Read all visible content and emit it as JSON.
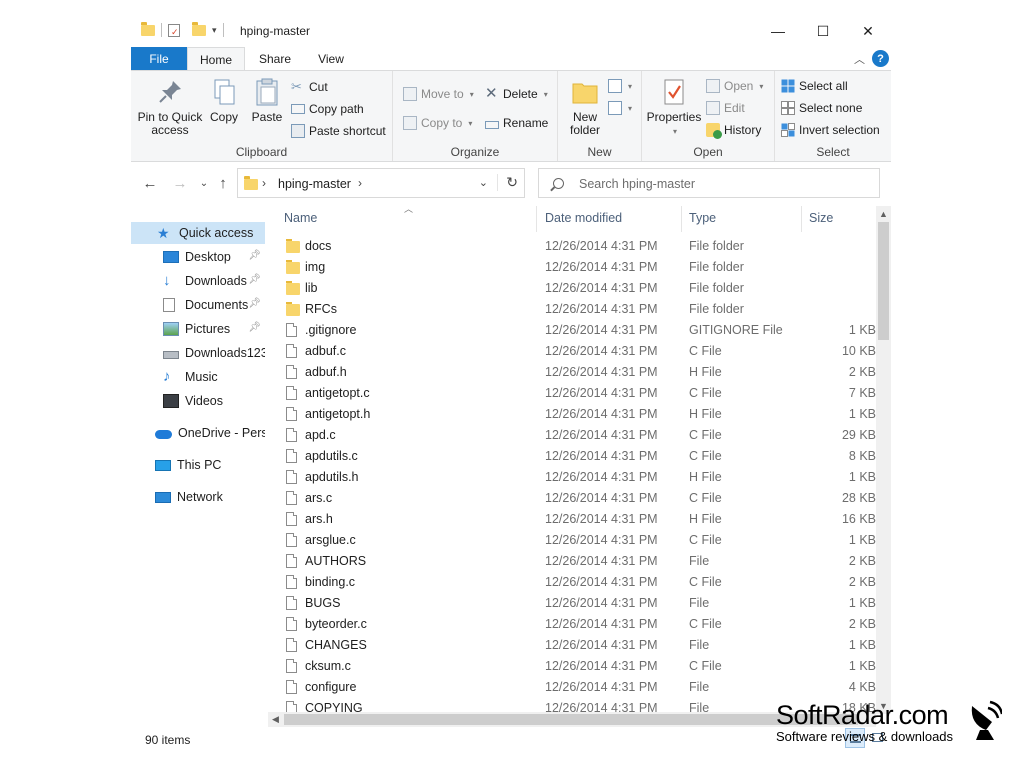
{
  "window": {
    "title": "hping-master",
    "controls": {
      "minimize": "—",
      "maximize": "☐",
      "close": "✕"
    }
  },
  "tabs": {
    "file": "File",
    "home": "Home",
    "share": "Share",
    "view": "View"
  },
  "ribbon": {
    "clipboard": {
      "label": "Clipboard",
      "pin_line1": "Pin to Quick",
      "pin_line2": "access",
      "copy": "Copy",
      "paste": "Paste",
      "cut": "Cut",
      "copy_path": "Copy path",
      "paste_shortcut": "Paste shortcut"
    },
    "organize": {
      "label": "Organize",
      "move_to": "Move to",
      "copy_to": "Copy to",
      "delete": "Delete",
      "rename": "Rename"
    },
    "new": {
      "label": "New",
      "new_folder_line1": "New",
      "new_folder_line2": "folder"
    },
    "open": {
      "label": "Open",
      "properties": "Properties",
      "open": "Open",
      "edit": "Edit",
      "history": "History"
    },
    "select": {
      "label": "Select",
      "select_all": "Select all",
      "select_none": "Select none",
      "invert_selection": "Invert selection"
    }
  },
  "address": {
    "path": "hping-master",
    "search_placeholder": "Search hping-master"
  },
  "sidebar": {
    "quick_access": "Quick access",
    "items": [
      "Desktop",
      "Downloads",
      "Documents",
      "Pictures",
      "Downloads123",
      "Music",
      "Videos"
    ],
    "onedrive": "OneDrive - Perso",
    "this_pc": "This PC",
    "network": "Network"
  },
  "columns": {
    "name": "Name",
    "date": "Date modified",
    "type": "Type",
    "size": "Size"
  },
  "files": [
    {
      "name": "docs",
      "date": "12/26/2014 4:31 PM",
      "type": "File folder",
      "size": ""
    },
    {
      "name": "img",
      "date": "12/26/2014 4:31 PM",
      "type": "File folder",
      "size": ""
    },
    {
      "name": "lib",
      "date": "12/26/2014 4:31 PM",
      "type": "File folder",
      "size": ""
    },
    {
      "name": "RFCs",
      "date": "12/26/2014 4:31 PM",
      "type": "File folder",
      "size": ""
    },
    {
      "name": ".gitignore",
      "date": "12/26/2014 4:31 PM",
      "type": "GITIGNORE File",
      "size": "1 KB"
    },
    {
      "name": "adbuf.c",
      "date": "12/26/2014 4:31 PM",
      "type": "C File",
      "size": "10 KB"
    },
    {
      "name": "adbuf.h",
      "date": "12/26/2014 4:31 PM",
      "type": "H File",
      "size": "2 KB"
    },
    {
      "name": "antigetopt.c",
      "date": "12/26/2014 4:31 PM",
      "type": "C File",
      "size": "7 KB"
    },
    {
      "name": "antigetopt.h",
      "date": "12/26/2014 4:31 PM",
      "type": "H File",
      "size": "1 KB"
    },
    {
      "name": "apd.c",
      "date": "12/26/2014 4:31 PM",
      "type": "C File",
      "size": "29 KB"
    },
    {
      "name": "apdutils.c",
      "date": "12/26/2014 4:31 PM",
      "type": "C File",
      "size": "8 KB"
    },
    {
      "name": "apdutils.h",
      "date": "12/26/2014 4:31 PM",
      "type": "H File",
      "size": "1 KB"
    },
    {
      "name": "ars.c",
      "date": "12/26/2014 4:31 PM",
      "type": "C File",
      "size": "28 KB"
    },
    {
      "name": "ars.h",
      "date": "12/26/2014 4:31 PM",
      "type": "H File",
      "size": "16 KB"
    },
    {
      "name": "arsglue.c",
      "date": "12/26/2014 4:31 PM",
      "type": "C File",
      "size": "1 KB"
    },
    {
      "name": "AUTHORS",
      "date": "12/26/2014 4:31 PM",
      "type": "File",
      "size": "2 KB"
    },
    {
      "name": "binding.c",
      "date": "12/26/2014 4:31 PM",
      "type": "C File",
      "size": "2 KB"
    },
    {
      "name": "BUGS",
      "date": "12/26/2014 4:31 PM",
      "type": "File",
      "size": "1 KB"
    },
    {
      "name": "byteorder.c",
      "date": "12/26/2014 4:31 PM",
      "type": "C File",
      "size": "2 KB"
    },
    {
      "name": "CHANGES",
      "date": "12/26/2014 4:31 PM",
      "type": "File",
      "size": "1 KB"
    },
    {
      "name": "cksum.c",
      "date": "12/26/2014 4:31 PM",
      "type": "C File",
      "size": "1 KB"
    },
    {
      "name": "configure",
      "date": "12/26/2014 4:31 PM",
      "type": "File",
      "size": "4 KB"
    },
    {
      "name": "COPYING",
      "date": "12/26/2014 4:31 PM",
      "type": "File",
      "size": "18 KB"
    }
  ],
  "status": {
    "count": "90 items"
  },
  "watermark": {
    "title": "SoftRadar.com",
    "subtitle": "Software reviews & downloads"
  },
  "colors": {
    "accent": "#1979ca",
    "folder": "#f8d56b",
    "selection": "#cce4f7"
  }
}
